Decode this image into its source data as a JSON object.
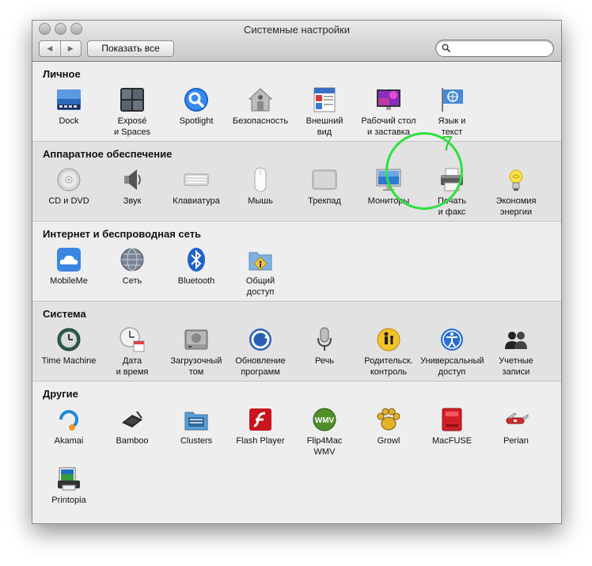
{
  "window": {
    "title": "Системные настройки",
    "nav_back": "◀",
    "nav_forward": "▶",
    "show_all": "Показать все",
    "search_placeholder": ""
  },
  "sections": [
    {
      "title": "Личное",
      "items": [
        {
          "label": "Dock",
          "icon": "dock-icon"
        },
        {
          "label": "Exposé\nи Spaces",
          "icon": "expose-icon"
        },
        {
          "label": "Spotlight",
          "icon": "spotlight-icon"
        },
        {
          "label": "Безопасность",
          "icon": "security-house-icon"
        },
        {
          "label": "Внешний\nвид",
          "icon": "appearance-icon"
        },
        {
          "label": "Рабочий стол\nи заставка",
          "icon": "desktop-screensaver-icon"
        },
        {
          "label": "Язык и\nтекст",
          "icon": "language-flag-icon"
        }
      ]
    },
    {
      "title": "Аппаратное обеспечение",
      "items": [
        {
          "label": "CD и DVD",
          "icon": "cd-dvd-icon"
        },
        {
          "label": "Звук",
          "icon": "speaker-icon"
        },
        {
          "label": "Клавиатура",
          "icon": "keyboard-icon"
        },
        {
          "label": "Мышь",
          "icon": "mouse-icon"
        },
        {
          "label": "Трекпад",
          "icon": "trackpad-icon"
        },
        {
          "label": "Мониторы",
          "icon": "display-icon"
        },
        {
          "label": "Печать\nи факс",
          "icon": "printer-icon"
        },
        {
          "label": "Экономия\nэнергии",
          "icon": "lightbulb-icon"
        }
      ]
    },
    {
      "title": "Интернет и беспроводная сеть",
      "items": [
        {
          "label": "MobileMe",
          "icon": "cloud-icon"
        },
        {
          "label": "Сеть",
          "icon": "network-globe-icon"
        },
        {
          "label": "Bluetooth",
          "icon": "bluetooth-icon"
        },
        {
          "label": "Общий\nдоступ",
          "icon": "sharing-folder-icon"
        }
      ]
    },
    {
      "title": "Система",
      "items": [
        {
          "label": "Time Machine",
          "icon": "time-machine-icon"
        },
        {
          "label": "Дата\nи время",
          "icon": "clock-calendar-icon"
        },
        {
          "label": "Загрузочный\nтом",
          "icon": "hard-disk-icon"
        },
        {
          "label": "Обновление\nпрограмм",
          "icon": "software-update-icon"
        },
        {
          "label": "Речь",
          "icon": "microphone-icon"
        },
        {
          "label": "Родительск.\nконтроль",
          "icon": "parental-controls-icon"
        },
        {
          "label": "Универсальный\nдоступ",
          "icon": "universal-access-icon"
        },
        {
          "label": "Учетные\nзаписи",
          "icon": "accounts-icon"
        }
      ]
    },
    {
      "title": "Другие",
      "items": [
        {
          "label": "Akamai",
          "icon": "akamai-icon"
        },
        {
          "label": "Bamboo",
          "icon": "bamboo-tablet-icon"
        },
        {
          "label": "Clusters",
          "icon": "clusters-icon"
        },
        {
          "label": "Flash Player",
          "icon": "flash-player-icon"
        },
        {
          "label": "Flip4Mac\nWMV",
          "icon": "flip4mac-wmv-icon"
        },
        {
          "label": "Growl",
          "icon": "growl-paw-icon"
        },
        {
          "label": "MacFUSE",
          "icon": "macfuse-icon"
        },
        {
          "label": "Perian",
          "icon": "perian-knife-icon"
        },
        {
          "label": "Printopia",
          "icon": "printopia-icon"
        }
      ]
    }
  ],
  "annotation": {
    "number": "7",
    "color": "#2ee03c"
  }
}
